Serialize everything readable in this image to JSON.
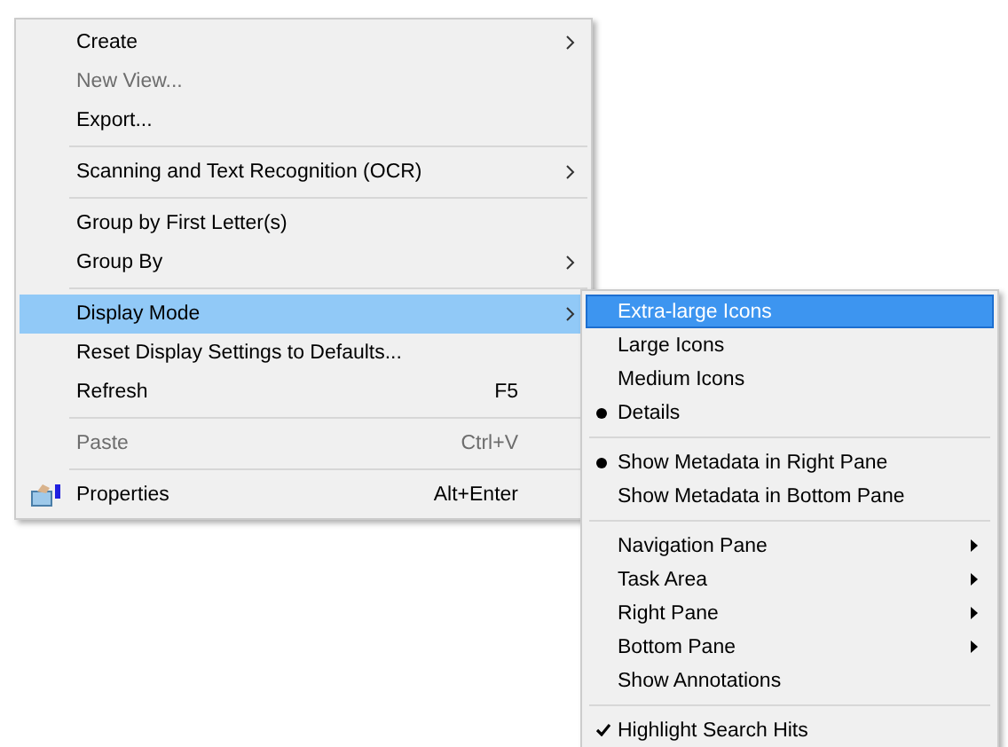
{
  "context_menu": {
    "items": [
      {
        "kind": "submenu",
        "label": "Create",
        "disabled": false,
        "selected": false
      },
      {
        "kind": "command",
        "label": "New View...",
        "disabled": true,
        "selected": false
      },
      {
        "kind": "command",
        "label": "Export...",
        "disabled": false,
        "selected": false
      },
      {
        "kind": "separator"
      },
      {
        "kind": "submenu",
        "label": "Scanning and Text Recognition (OCR)",
        "disabled": false,
        "selected": false
      },
      {
        "kind": "separator"
      },
      {
        "kind": "command",
        "label": "Group by First Letter(s)",
        "disabled": false,
        "selected": false
      },
      {
        "kind": "submenu",
        "label": "Group By",
        "disabled": false,
        "selected": false
      },
      {
        "kind": "separator"
      },
      {
        "kind": "submenu",
        "label": "Display Mode",
        "disabled": false,
        "selected": true
      },
      {
        "kind": "command",
        "label": "Reset Display Settings to Defaults...",
        "disabled": false,
        "selected": false
      },
      {
        "kind": "command",
        "label": "Refresh",
        "shortcut": "F5",
        "disabled": false,
        "selected": false
      },
      {
        "kind": "separator"
      },
      {
        "kind": "command",
        "label": "Paste",
        "shortcut": "Ctrl+V",
        "disabled": true,
        "selected": false
      },
      {
        "kind": "separator"
      },
      {
        "kind": "command",
        "label": "Properties",
        "shortcut": "Alt+Enter",
        "icon": true,
        "disabled": false,
        "selected": false
      }
    ]
  },
  "display_mode_submenu": {
    "items": [
      {
        "kind": "radio",
        "label": "Extra-large Icons",
        "checked": false,
        "selected": true
      },
      {
        "kind": "radio",
        "label": "Large Icons",
        "checked": false,
        "selected": false
      },
      {
        "kind": "radio",
        "label": "Medium Icons",
        "checked": false,
        "selected": false
      },
      {
        "kind": "radio",
        "label": "Details",
        "checked": true,
        "selected": false
      },
      {
        "kind": "separator"
      },
      {
        "kind": "radio",
        "label": "Show Metadata in Right Pane",
        "checked": true,
        "selected": false
      },
      {
        "kind": "radio",
        "label": "Show Metadata in Bottom Pane",
        "checked": false,
        "selected": false
      },
      {
        "kind": "separator"
      },
      {
        "kind": "submenu",
        "label": "Navigation Pane",
        "selected": false
      },
      {
        "kind": "submenu",
        "label": "Task Area",
        "selected": false
      },
      {
        "kind": "submenu",
        "label": "Right Pane",
        "selected": false
      },
      {
        "kind": "submenu",
        "label": "Bottom Pane",
        "selected": false
      },
      {
        "kind": "command",
        "label": "Show Annotations",
        "selected": false
      },
      {
        "kind": "separator"
      },
      {
        "kind": "check",
        "label": "Highlight Search Hits",
        "checked": true,
        "selected": false
      }
    ]
  }
}
